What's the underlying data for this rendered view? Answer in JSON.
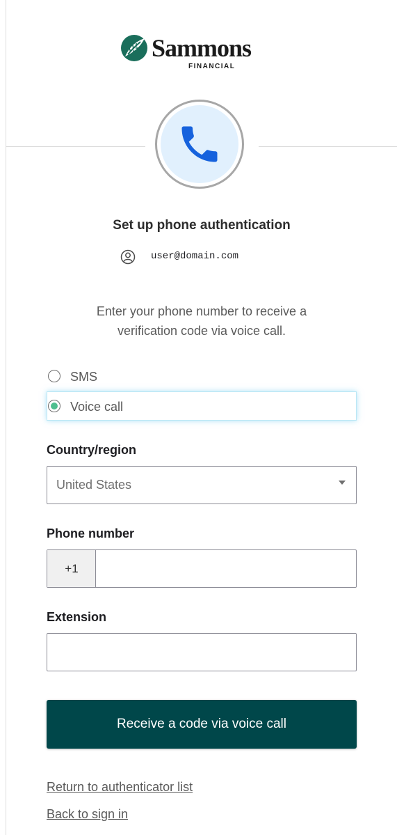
{
  "brand": {
    "name": "Sammons",
    "subtitle": "FINANCIAL",
    "accent_color": "#00474a",
    "logo_mark_color": "#1a6e5b"
  },
  "header": {
    "icon": "phone-icon",
    "title": "Set up phone authentication",
    "identity_icon": "user-icon",
    "identity": "user@domain.com"
  },
  "instructions": {
    "line1": "Enter your phone number to receive a",
    "line2": "verification code via voice call."
  },
  "method_options": [
    {
      "label": "SMS",
      "selected": false
    },
    {
      "label": "Voice call",
      "selected": true
    }
  ],
  "country": {
    "label": "Country/region",
    "value": "United States"
  },
  "phone": {
    "label": "Phone number",
    "prefix": "+1",
    "value": ""
  },
  "extension": {
    "label": "Extension",
    "value": ""
  },
  "submit_label": "Receive a code via voice call",
  "links": {
    "return": "Return to authenticator list",
    "back": "Back to sign in"
  }
}
